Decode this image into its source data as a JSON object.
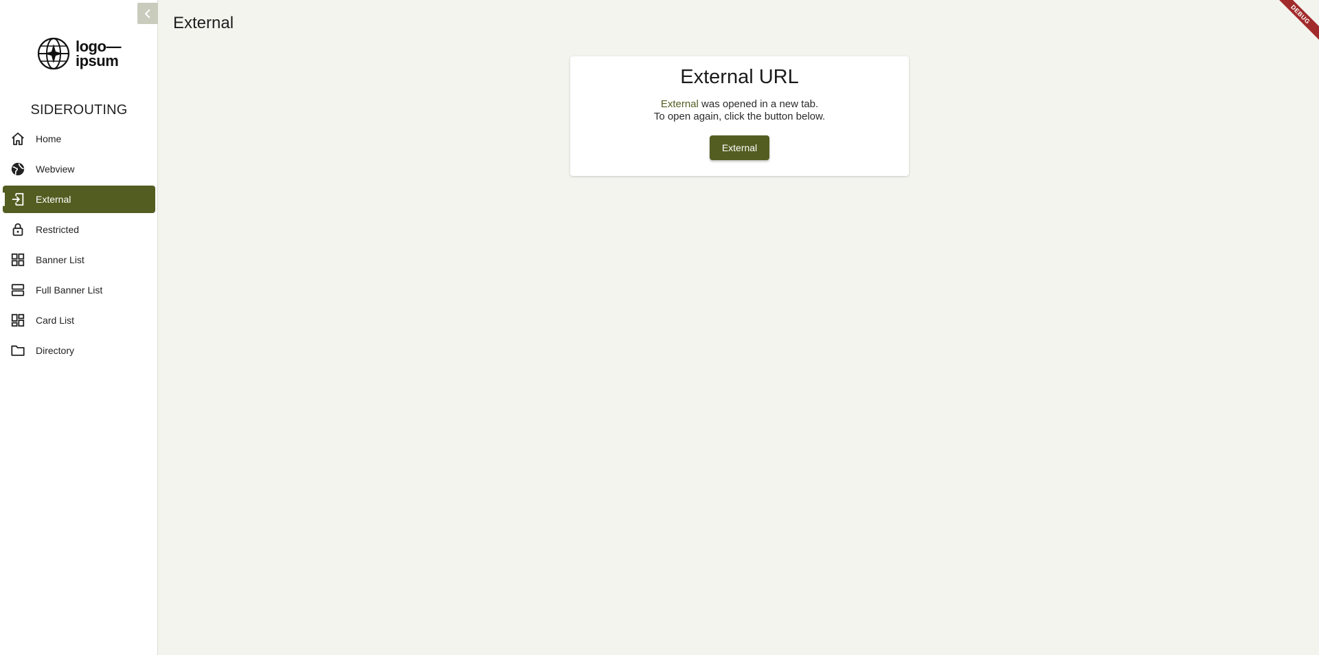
{
  "sidebar": {
    "logo": {
      "line1": "logo",
      "line2": "ipsum",
      "dash": "—"
    },
    "app_title": "SIDEROUTING",
    "items": [
      {
        "label": "Home",
        "icon": "home-icon"
      },
      {
        "label": "Webview",
        "icon": "globe-icon"
      },
      {
        "label": "External",
        "icon": "external-login-icon",
        "active": true
      },
      {
        "label": "Restricted",
        "icon": "lock-icon"
      },
      {
        "label": "Banner List",
        "icon": "grid-icon"
      },
      {
        "label": "Full Banner List",
        "icon": "rows-icon"
      },
      {
        "label": "Card List",
        "icon": "dashboard-icon"
      },
      {
        "label": "Directory",
        "icon": "folder-icon"
      }
    ]
  },
  "header": {
    "title": "External"
  },
  "card": {
    "title": "External URL",
    "accent_word": "External",
    "line1_rest": " was opened in a new tab.",
    "line2": "To open again, click the button below.",
    "button_label": "External"
  },
  "debug_banner": "DEBUG",
  "colors": {
    "accent": "#535d21",
    "background": "#f4f4ef",
    "sidebar": "#ffffff",
    "debug": "#a12b2b"
  }
}
